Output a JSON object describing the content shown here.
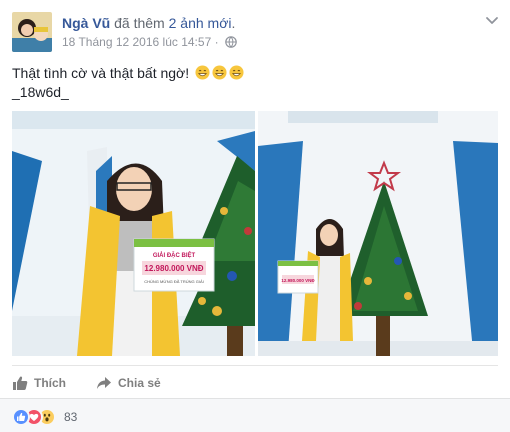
{
  "header": {
    "author_name": "Ngà Vũ",
    "action_text": "đã thêm",
    "action_link": "2 ảnh mới",
    "action_end": ".",
    "timestamp": "18 Tháng 12 2016 lúc 14:57",
    "separator": "·"
  },
  "post": {
    "text": "Thật tình cờ và thật bất ngờ!",
    "tag": "_18w6d_"
  },
  "photo_left": {
    "sign_top": "GIẢI ĐẶC BIỆT",
    "sign_amount": "12.980.000 VNĐ",
    "sign_bottom": "CHÚNG MỪNG ĐÃ TRÚNG GIẢI"
  },
  "photo_right": {
    "sign_amount": "12.980.000 VNĐ"
  },
  "actions": {
    "like_label": "Thích",
    "share_label": "Chia sẻ"
  },
  "reactions": {
    "count": "83",
    "types": [
      "like",
      "love",
      "wow"
    ]
  },
  "colors": {
    "link": "#365899",
    "like_blue": "#5890ff",
    "love_red": "#f25268",
    "wow_yellow": "#fbcd5f"
  }
}
